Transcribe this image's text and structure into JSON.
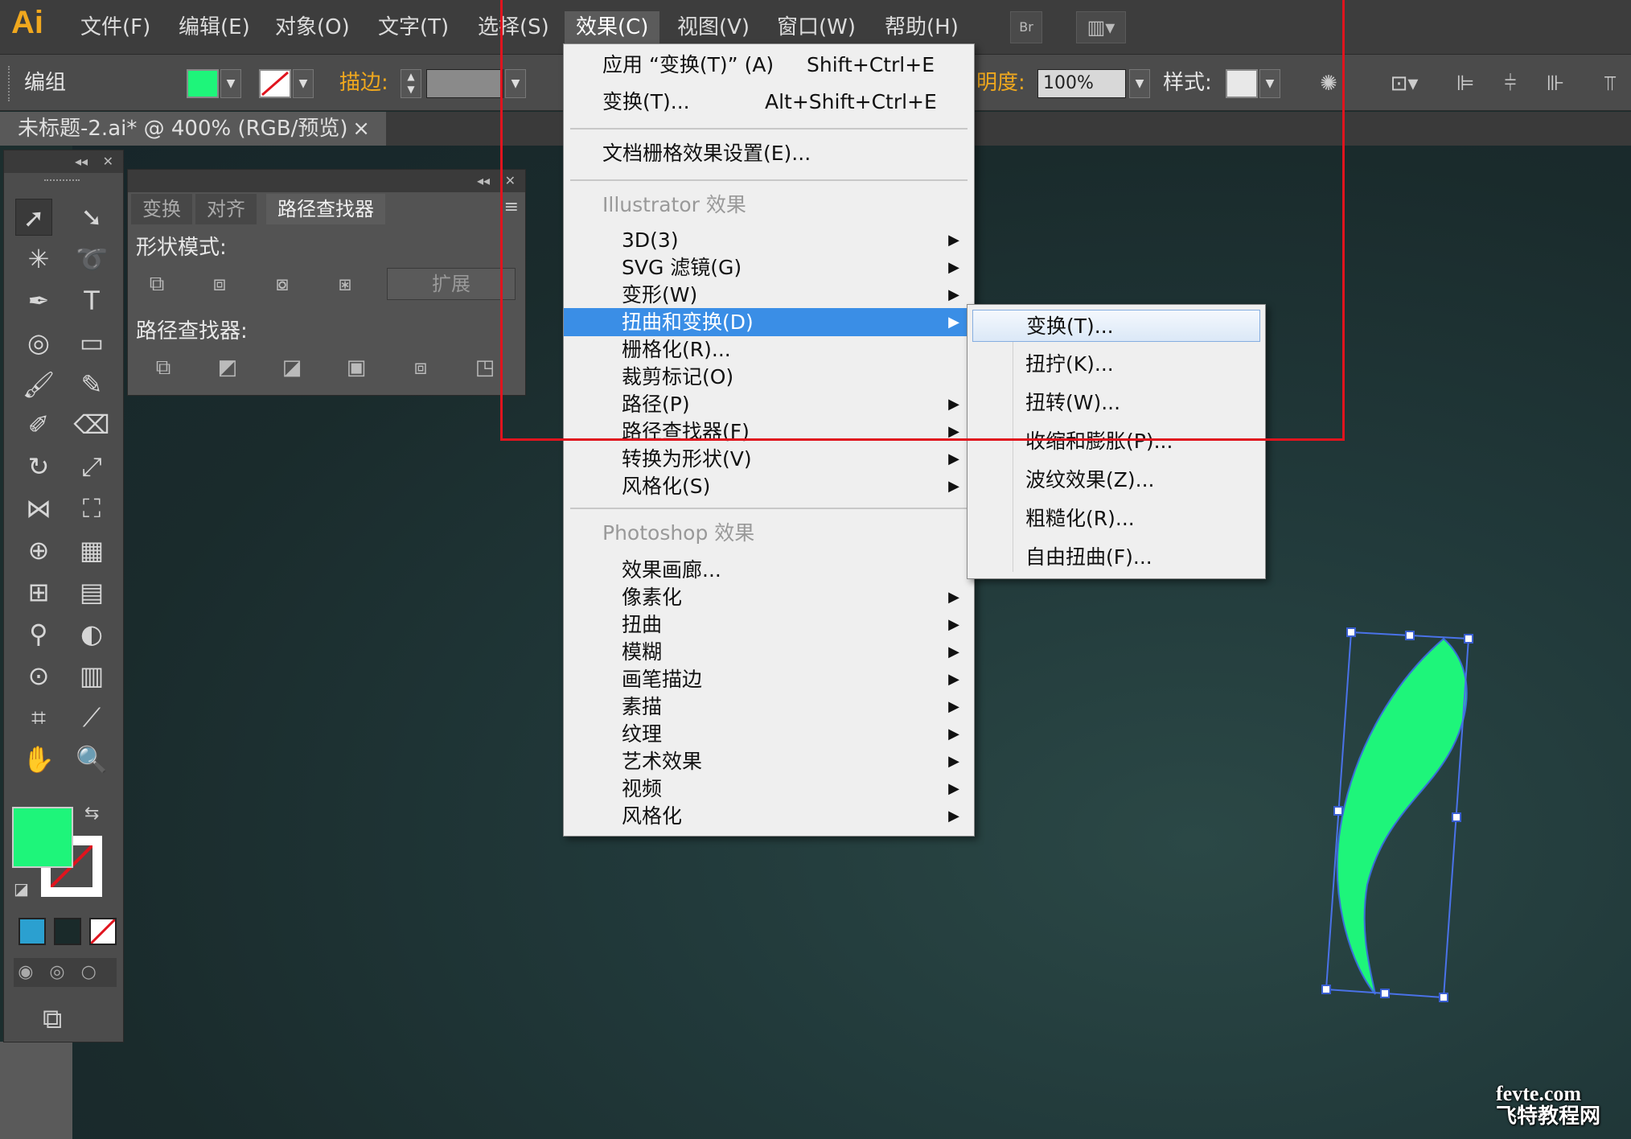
{
  "app": {
    "logo": "Ai"
  },
  "menubar": {
    "items": [
      "文件(F)",
      "编辑(E)",
      "对象(O)",
      "文字(T)",
      "选择(S)",
      "效果(C)",
      "视图(V)",
      "窗口(W)",
      "帮助(H)"
    ],
    "active": "效果(C)",
    "bridge_label": "Br"
  },
  "control_bar": {
    "selection_label": "编组",
    "stroke_label": "描边:",
    "opacity_label": "明度:",
    "opacity_value": "100%",
    "style_label": "样式:"
  },
  "document_tab": {
    "title": "未标题-2.ai* @ 400% (RGB/预览)",
    "close": "×"
  },
  "panel": {
    "tabs": [
      "变换",
      "对齐",
      "路径查找器"
    ],
    "active_tab": "路径查找器",
    "shape_modes_label": "形状模式:",
    "expand_label": "扩展",
    "pathfinder_label": "路径查找器:"
  },
  "effect_menu": {
    "apply": {
      "label": "应用 “变换(T)” (A)",
      "shortcut": "Shift+Ctrl+E"
    },
    "transform": {
      "label": "变换(T)...",
      "shortcut": "Alt+Shift+Ctrl+E"
    },
    "raster_settings": "文档栅格效果设置(E)...",
    "illustrator_header": "Illustrator 效果",
    "illustrator_items": [
      {
        "label": "3D(3)",
        "submenu": true
      },
      {
        "label": "SVG 滤镜(G)",
        "submenu": true
      },
      {
        "label": "变形(W)",
        "submenu": true
      },
      {
        "label": "扭曲和变换(D)",
        "submenu": true,
        "highlighted": true
      },
      {
        "label": "栅格化(R)...",
        "submenu": false
      },
      {
        "label": "裁剪标记(O)",
        "submenu": false
      },
      {
        "label": "路径(P)",
        "submenu": true
      },
      {
        "label": "路径查找器(F)",
        "submenu": true
      },
      {
        "label": "转换为形状(V)",
        "submenu": true
      },
      {
        "label": "风格化(S)",
        "submenu": true
      }
    ],
    "photoshop_header": "Photoshop 效果",
    "photoshop_items": [
      {
        "label": "效果画廊...",
        "submenu": false
      },
      {
        "label": "像素化",
        "submenu": true
      },
      {
        "label": "扭曲",
        "submenu": true
      },
      {
        "label": "模糊",
        "submenu": true
      },
      {
        "label": "画笔描边",
        "submenu": true
      },
      {
        "label": "素描",
        "submenu": true
      },
      {
        "label": "纹理",
        "submenu": true
      },
      {
        "label": "艺术效果",
        "submenu": true
      },
      {
        "label": "视频",
        "submenu": true
      },
      {
        "label": "风格化",
        "submenu": true
      }
    ]
  },
  "distort_submenu": {
    "items": [
      "变换(T)...",
      "扭拧(K)...",
      "扭转(W)...",
      "收缩和膨胀(P)...",
      "波纹效果(Z)...",
      "粗糙化(R)...",
      "自由扭曲(F)..."
    ],
    "highlighted": "变换(T)..."
  },
  "colors": {
    "fill": "#1ef57a",
    "highlight": "#3a8ee6",
    "annotation": "#e0141e",
    "accent": "#f0a81e"
  },
  "watermark": {
    "line1": "fevte.com",
    "line2": "飞特教程网"
  }
}
